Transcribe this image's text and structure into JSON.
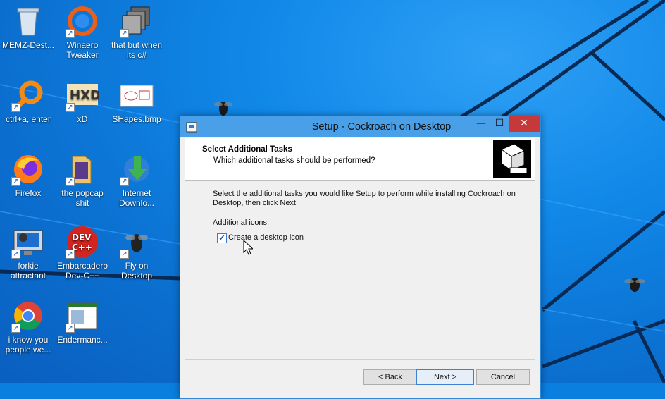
{
  "desktop": {
    "icons": [
      {
        "label": "MEMZ-Dest..."
      },
      {
        "label": "Winaero Tweaker"
      },
      {
        "label": "that but when its c#"
      },
      {
        "label": "ctrl+a, enter"
      },
      {
        "label": "xD"
      },
      {
        "label": "SHapes.bmp"
      },
      {
        "label": "Firefox"
      },
      {
        "label": "the popcap shit"
      },
      {
        "label": "Internet Downlo..."
      },
      {
        "label": "forkie attractant"
      },
      {
        "label": "Embarcadero Dev-C++"
      },
      {
        "label": "Fly on Desktop"
      },
      {
        "label": "i know you people we..."
      },
      {
        "label": "Endermanc..."
      }
    ]
  },
  "dialog": {
    "title": "Setup - Cockroach on Desktop",
    "window_controls": {
      "minimize": "—",
      "maximize": "☐",
      "close": "✕"
    },
    "header_title": "Select Additional Tasks",
    "header_subtitle": "Which additional tasks should be performed?",
    "description": "Select the additional tasks you would like Setup to perform while installing Cockroach on Desktop, then click Next.",
    "icons_label": "Additional icons:",
    "checkbox": {
      "label": "Create a desktop icon",
      "checked": true,
      "mark": "✔"
    },
    "buttons": {
      "back": "< Back",
      "next": "Next >",
      "cancel": "Cancel"
    }
  }
}
